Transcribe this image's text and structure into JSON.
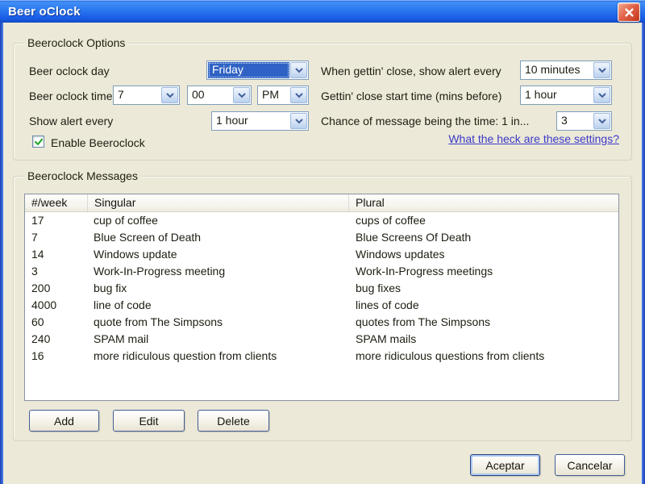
{
  "window": {
    "title": "Beer oClock"
  },
  "options": {
    "legend": "Beeroclock Options",
    "day_label": "Beer oclock day",
    "day_value": "Friday",
    "time_label": "Beer oclock time",
    "time_hour": "7",
    "time_minute": "00",
    "time_ampm": "PM",
    "show_alert_label": "Show alert every",
    "show_alert_value": "1 hour",
    "gettin_close_alert_label": "When gettin' close, show alert every",
    "gettin_close_alert_value": "10 minutes",
    "gettin_close_start_label": "Gettin' close start time (mins before)",
    "gettin_close_start_value": "1 hour",
    "chance_label": "Chance of message being the time: 1 in...",
    "chance_value": "3",
    "enable_checkbox_label": "Enable Beeroclock",
    "enable_checked": true,
    "help_link": "What the heck are these settings?"
  },
  "messages": {
    "legend": "Beeroclock Messages",
    "columns": [
      "#/week",
      "Singular",
      "Plural"
    ],
    "rows": [
      [
        "17",
        "cup of coffee",
        "cups of coffee"
      ],
      [
        "7",
        "Blue Screen of Death",
        "Blue Screens Of Death"
      ],
      [
        "14",
        "Windows update",
        "Windows updates"
      ],
      [
        "3",
        "Work-In-Progress meeting",
        "Work-In-Progress meetings"
      ],
      [
        "200",
        "bug fix",
        "bug fixes"
      ],
      [
        "4000",
        "line of code",
        "lines of code"
      ],
      [
        "60",
        "quote from The Simpsons",
        "quotes from The Simpsons"
      ],
      [
        "240",
        "SPAM mail",
        "SPAM mails"
      ],
      [
        "16",
        "more ridiculous question from clients",
        "more ridiculous questions from clients"
      ]
    ],
    "add_button": "Add",
    "edit_button": "Edit",
    "delete_button": "Delete"
  },
  "footer": {
    "ok_button": "Aceptar",
    "cancel_button": "Cancelar"
  },
  "icons": {
    "close": "close-icon",
    "combo_arrow": "chevron-down-icon",
    "check": "checkmark-icon"
  },
  "colors": {
    "titlebar_blue": "#2E6FE8",
    "selection_blue": "#2F62C4",
    "link": "#3A3AC8",
    "close_red": "#D8432B",
    "check_green": "#23A523",
    "dialog_bg": "#ECE9D8"
  }
}
